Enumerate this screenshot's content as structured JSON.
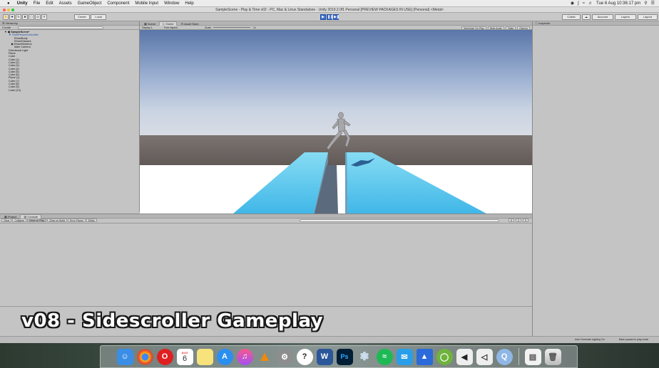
{
  "menubar": {
    "apple": "",
    "app": "Unity",
    "items": [
      "File",
      "Edit",
      "Assets",
      "GameObject",
      "Component",
      "Mobile Input",
      "Window",
      "Help"
    ],
    "clock": "Tue 6 Aug  10:36:17 pm"
  },
  "window": {
    "title": "SampleScene - Play & Time v02 - PC, Mac & Linux Standalone - Unity 2019.2.0f1 Personal [PREVIEW PACKAGES IN USE] (Personal) <Metal>"
  },
  "toolbar": {
    "center": "Center",
    "local": "Local",
    "collab": "Collab",
    "account": "Account",
    "layers": "Layers",
    "layout": "Layout"
  },
  "hierarchy": {
    "tab": "Hierarchy",
    "create": "Create",
    "scene": "SampleScene*",
    "items": [
      "ThirdPersonController",
      "EthanBody",
      "EthanGlasses",
      "EthanSkeleton",
      "Main Camera",
      "Directional Light",
      "Plane",
      "Cube",
      "Cube (1)",
      "Cube (2)",
      "Cube (3)",
      "Cube (4)",
      "Cube (5)",
      "Cube (6)",
      "Plane (1)",
      "Cube (7)",
      "Cube (8)",
      "Cube (9)",
      "Cube (10)"
    ]
  },
  "game_panel": {
    "tabs": [
      "Scene",
      "Game",
      "Asset Store"
    ],
    "display": "Display 1",
    "aspect": "Free Aspect",
    "scale_label": "Scale",
    "scale_value": "1x",
    "toggles": [
      "Maximize On Play",
      "Mute Audio",
      "Stats",
      "Gizmos"
    ]
  },
  "inspector": {
    "tab": "Inspector"
  },
  "console": {
    "tabs": [
      "Project",
      "Console"
    ],
    "buttons": [
      "Clear",
      "Collapse",
      "Clear on Play",
      "Clear on Build",
      "Error Pause",
      "Editor"
    ],
    "counts": [
      "0",
      "0",
      "0"
    ]
  },
  "status": {
    "lighting": "Auto Generate Lighting On",
    "bake": "Bake paused in play mode"
  },
  "caption": "v08 - Sidescroller Gameplay",
  "dock": {
    "calendar_month": "AUG",
    "calendar_day": "6",
    "icons": [
      "finder-icon",
      "chrome-icon",
      "opera-icon",
      "calendar-icon",
      "notes-icon",
      "app-store-icon",
      "itunes-icon",
      "vlc-icon",
      "system-preferences-icon",
      "quicktime-icon",
      "word-icon",
      "photoshop-icon",
      "inkscape-icon",
      "spotify-icon",
      "messages-icon",
      "sourcetree-icon",
      "unity-hub-icon",
      "visual-studio-icon",
      "unity-icon",
      "quicktime-player-icon",
      "preview-icon",
      "trash-icon"
    ]
  }
}
